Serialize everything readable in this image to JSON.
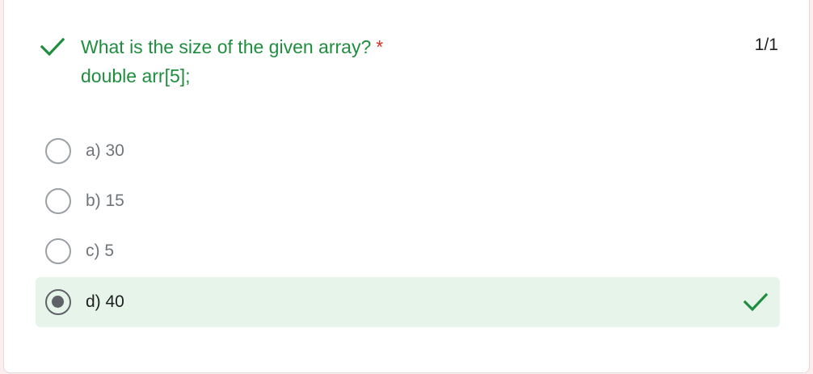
{
  "question": {
    "line1": "What is the size of the given array?",
    "required_marker": "*",
    "line2": "double arr[5];",
    "score": "1/1",
    "status_icon": "checkmark-icon"
  },
  "options": [
    {
      "label": "a) 30",
      "selected": false,
      "correct": false
    },
    {
      "label": "b) 15",
      "selected": false,
      "correct": false
    },
    {
      "label": "c) 5",
      "selected": false,
      "correct": false
    },
    {
      "label": "d) 40",
      "selected": true,
      "correct": true
    }
  ],
  "colors": {
    "correct_green": "#1e8e3e",
    "correct_bg": "#e6f4ea",
    "required_red": "#d93025"
  }
}
